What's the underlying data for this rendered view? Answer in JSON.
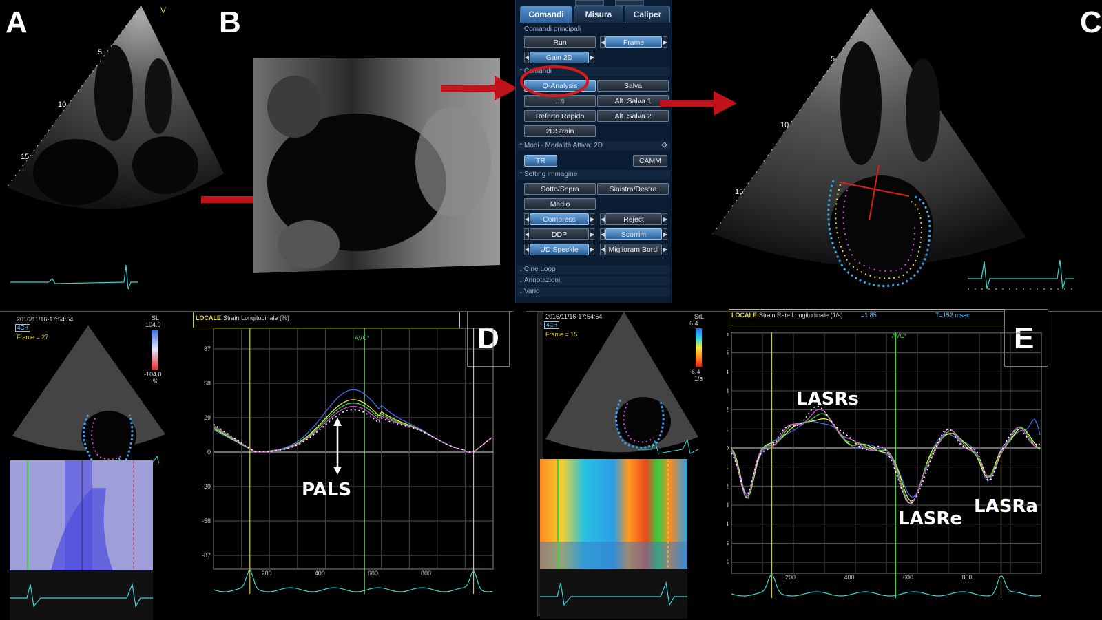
{
  "panels": {
    "a": "A",
    "b": "B",
    "c": "C",
    "d": "D",
    "e": "E"
  },
  "echo_a": {
    "apex_mark": "V",
    "depths": [
      "5",
      "10",
      "15"
    ]
  },
  "echo_c": {
    "depths": [
      "5",
      "10",
      "15"
    ]
  },
  "control_panel": {
    "tabs": [
      "Comandi",
      "Misura",
      "Caliper"
    ],
    "active_tab": "Comandi",
    "main_section": "Comandi principali",
    "run": "Run",
    "frame": "Frame",
    "gain2d": "Gain 2D",
    "comandi_section": "Comandi",
    "q_analysis": "Q-Analysis",
    "salva": "Salva",
    "hidden_btn": "...ti",
    "alt_salva_1": "Alt. Salva 1",
    "referto_rapido": "Referto Rapido",
    "alt_salva_2": "Alt. Salva 2",
    "strain2d": "2DStrain",
    "modi_section": "Modi - Modalità Attiva: 2D",
    "tr": "TR",
    "camm": "CAMM",
    "setting_section": "Setting immagine",
    "sotto_sopra": "Sotto/Sopra",
    "sinistra_destra": "Sinistra/Destra",
    "medio": "Medio",
    "compress": "Compress",
    "reject": "Reject",
    "ddp": "DDP",
    "scorrim": "Scorrim",
    "ud_speckle": "UD Speckle",
    "miglioram_bordi": "Miglioram Bordi",
    "cine_loop": "Cine Loop",
    "annotazioni": "Annotazioni",
    "vario": "Vario"
  },
  "colors": {
    "arrow_red": "#c0121b",
    "highlight_circle": "#d61a1a",
    "yellow_marker": "#d8d84a",
    "green_marker": "#3fd33f",
    "ecg_cyan": "#38d6d6"
  },
  "panel_d": {
    "timestamp": "2016/11/16-17:54:54",
    "view_badge": "4CH",
    "frame": "Frame = 27",
    "scale_unit": "SL",
    "scale_max": "104.0",
    "scale_min": "-104.0",
    "scale_pct": "%",
    "header_label": "LOCALE:",
    "header_title": "Strain Longitudinale (%)",
    "avc": "AVC*",
    "annotation": "PALS",
    "y_ticks": [
      "87",
      "58",
      "29",
      "0",
      "-29",
      "-58",
      "-87"
    ],
    "x_ticks": [
      "200",
      "400",
      "600",
      "800"
    ]
  },
  "panel_e": {
    "timestamp": "2016/11/16-17:54:54",
    "view_badge": "4CH",
    "frame": "Frame = 15",
    "scale_unit": "SrL",
    "scale_max": "6.4",
    "scale_min": "-6.4",
    "scale_unit2": "1/s",
    "header_label": "LOCALE:",
    "header_title": "Strain Rate Longitudinale (1/s)",
    "header_value": "=1.85",
    "header_time": "T=152 msec",
    "avc": "AVC*",
    "annotations": [
      "LASRs",
      "LASRe",
      "LASRa"
    ],
    "y_ticks": [
      "6",
      "5",
      "4",
      "3",
      "2",
      "1",
      "0",
      "-1",
      "-2",
      "-3",
      "-4",
      "-5",
      "-6"
    ],
    "x_ticks": [
      "200",
      "400",
      "600",
      "800"
    ]
  }
}
